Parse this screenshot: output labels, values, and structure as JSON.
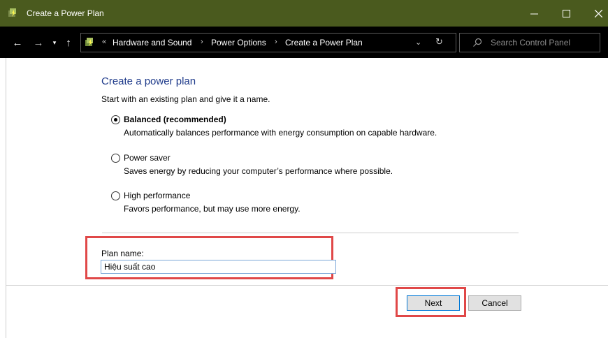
{
  "window": {
    "title": "Create a Power Plan",
    "titlebar_color": "#4a5a1e",
    "controls": {
      "minimize": "—",
      "maximize": "☐",
      "close": "✕"
    }
  },
  "nav": {
    "back": "←",
    "forward": "→",
    "recent": "▾",
    "up": "↑"
  },
  "address": {
    "overflow": "«",
    "breadcrumbs": [
      "Hardware and Sound",
      "Power Options",
      "Create a Power Plan"
    ],
    "separator": "›",
    "dropdown": "⌄",
    "refresh": "↻"
  },
  "search": {
    "placeholder": "Search Control Panel",
    "icon": "search-icon"
  },
  "content": {
    "heading": "Create a power plan",
    "subtitle": "Start with an existing plan and give it a name.",
    "options": [
      {
        "label": "Balanced (recommended)",
        "description": "Automatically balances performance with energy consumption on capable hardware.",
        "checked": true
      },
      {
        "label": "Power saver",
        "description": "Saves energy by reducing your computer’s performance where possible.",
        "checked": false
      },
      {
        "label": "High performance",
        "description": "Favors performance, but may use more energy.",
        "checked": false
      }
    ],
    "plan_name_label": "Plan name:",
    "plan_name_value": "Hiệu suất cao",
    "highlight_color": "#e04848"
  },
  "buttons": {
    "next": "Next",
    "cancel": "Cancel"
  }
}
